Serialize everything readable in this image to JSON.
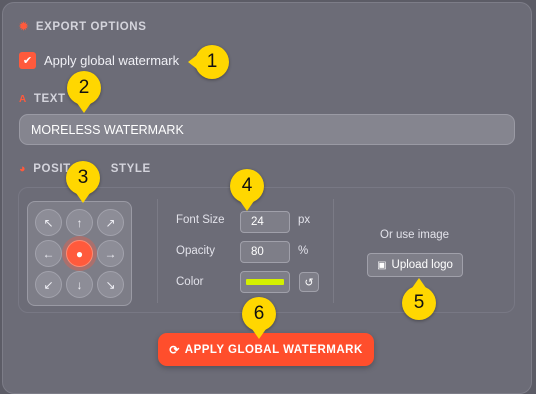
{
  "export_options": {
    "title": "EXPORT OPTIONS",
    "apply_global_label": "Apply global watermark",
    "apply_global_checked": true
  },
  "text_section": {
    "title": "TEXT",
    "value": "MORELESS WATERMARK"
  },
  "position_section": {
    "title_left": "POSIT",
    "title_right": "STYLE",
    "grid": [
      "↖",
      "↑",
      "↗",
      "←",
      "●",
      "→",
      "↙",
      "↓",
      "↘"
    ],
    "selected": "center"
  },
  "style": {
    "font_size_label": "Font Size",
    "font_size_value": "24",
    "font_size_unit": "px",
    "opacity_label": "Opacity",
    "opacity_value": "80",
    "opacity_unit": "%",
    "color_label": "Color",
    "color_value": "#d4f000",
    "reset_icon": "↺"
  },
  "image": {
    "or_text": "Or use image",
    "upload_label": "Upload logo"
  },
  "apply_button": {
    "label": "APPLY GLOBAL WATERMARK"
  },
  "callouts": [
    "1",
    "2",
    "3",
    "4",
    "5",
    "6"
  ],
  "colors": {
    "accent": "#ff5a3c",
    "callout": "#ffd700"
  }
}
